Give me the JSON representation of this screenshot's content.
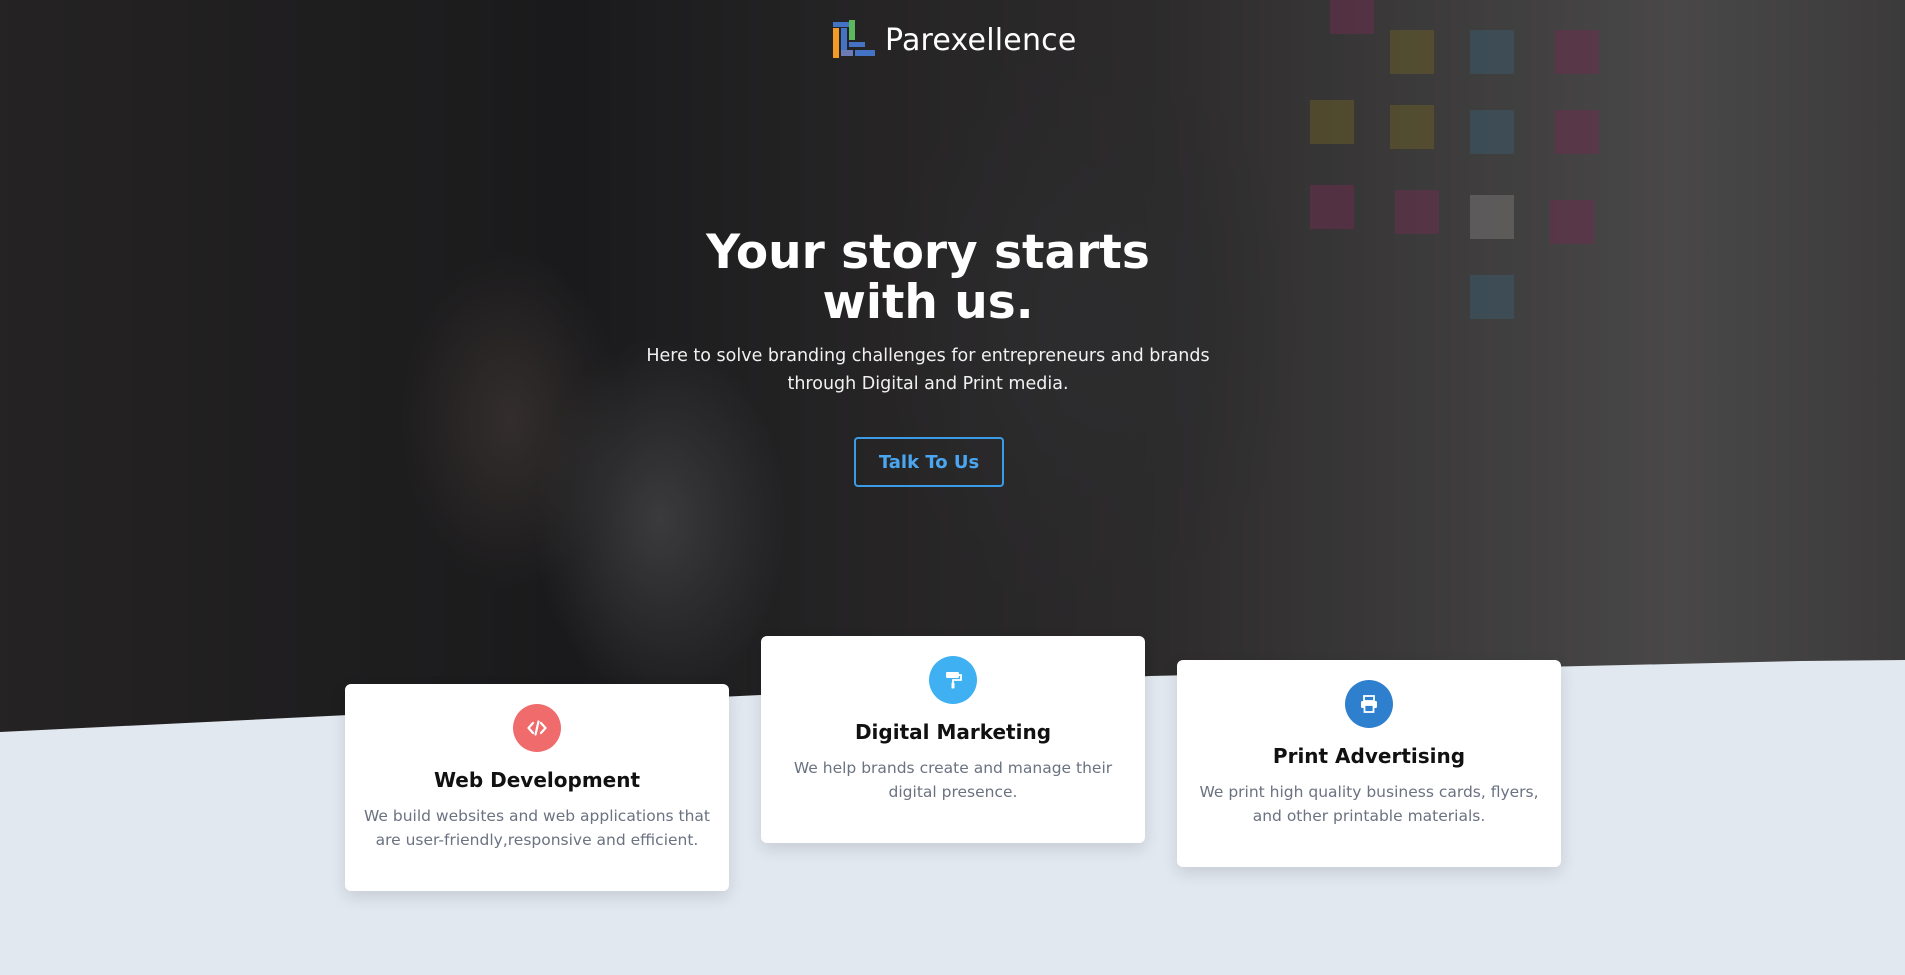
{
  "brand": {
    "name": "Parexellence",
    "logo_icon": "bars-logo-icon"
  },
  "hero": {
    "title": "Your story starts with us.",
    "subtitle": "Here to solve branding challenges for entrepreneurs and brands through Digital and Print media.",
    "cta_label": "Talk To Us",
    "cta_color": "#3b9be6"
  },
  "services": [
    {
      "title": "Web Development",
      "description": "We build websites and web applications that are user-friendly,responsive and efficient.",
      "icon": "code-icon",
      "icon_color": "#f06c6c"
    },
    {
      "title": "Digital Marketing",
      "description": "We help brands create and manage their digital presence.",
      "icon": "paint-roller-icon",
      "icon_color": "#3fb0f2"
    },
    {
      "title": "Print Advertising",
      "description": "We print high quality business cards, flyers, and other printable materials.",
      "icon": "printer-icon",
      "icon_color": "#2f7fcf"
    }
  ],
  "colors": {
    "page_background": "#e2e8f0",
    "card_background": "#ffffff"
  }
}
